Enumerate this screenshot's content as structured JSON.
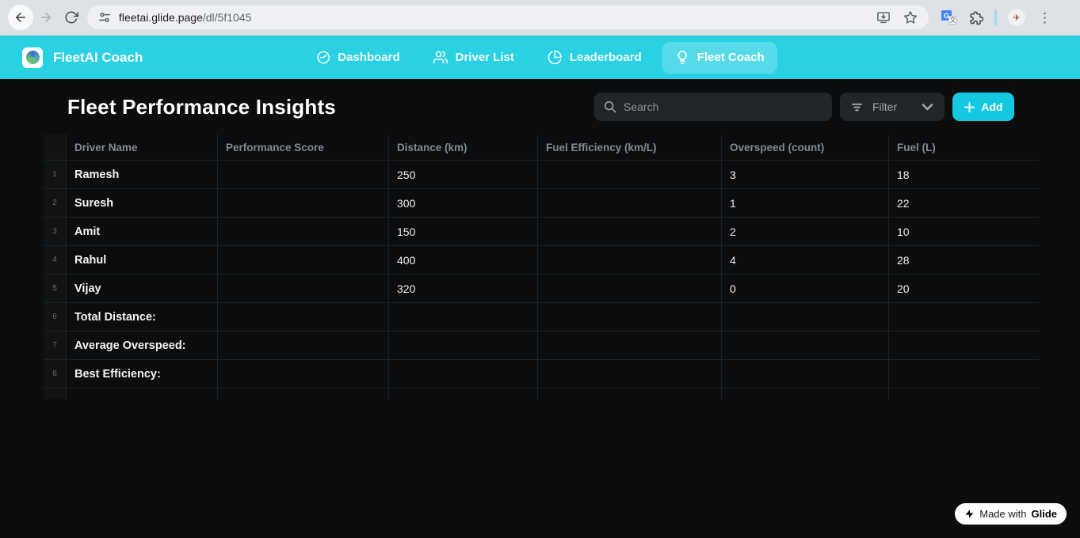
{
  "browser": {
    "url_host": "fleetai.glide.page",
    "url_path": "/dl/5f1045"
  },
  "header": {
    "app_title": "FleetAI Coach",
    "nav": [
      {
        "label": "Dashboard"
      },
      {
        "label": "Driver List"
      },
      {
        "label": "Leaderboard"
      },
      {
        "label": "Fleet Coach"
      }
    ]
  },
  "page": {
    "title": "Fleet Performance Insights",
    "search_placeholder": "Search",
    "filter_label": "Filter",
    "add_label": "Add"
  },
  "table": {
    "columns": [
      "Driver Name",
      "Performance Score",
      "Distance (km)",
      "Fuel Efficiency (km/L)",
      "Overspeed (count)",
      "Fuel (L)"
    ],
    "rows": [
      {
        "num": "1",
        "name": "Ramesh",
        "score": "",
        "distance": "250",
        "efficiency": "",
        "overspeed": "3",
        "fuel": "18"
      },
      {
        "num": "2",
        "name": "Suresh",
        "score": "",
        "distance": "300",
        "efficiency": "",
        "overspeed": "1",
        "fuel": "22"
      },
      {
        "num": "3",
        "name": "Amit",
        "score": "",
        "distance": "150",
        "efficiency": "",
        "overspeed": "2",
        "fuel": "10"
      },
      {
        "num": "4",
        "name": "Rahul",
        "score": "",
        "distance": "400",
        "efficiency": "",
        "overspeed": "4",
        "fuel": "28"
      },
      {
        "num": "5",
        "name": "Vijay",
        "score": "",
        "distance": "320",
        "efficiency": "",
        "overspeed": "0",
        "fuel": "20"
      },
      {
        "num": "6",
        "name": "Total Distance:",
        "score": "",
        "distance": "",
        "efficiency": "",
        "overspeed": "",
        "fuel": ""
      },
      {
        "num": "7",
        "name": "Average Overspeed:",
        "score": "",
        "distance": "",
        "efficiency": "",
        "overspeed": "",
        "fuel": ""
      },
      {
        "num": "8",
        "name": "Best Efficiency:",
        "score": "",
        "distance": "",
        "efficiency": "",
        "overspeed": "",
        "fuel": ""
      }
    ]
  },
  "badge": {
    "made_with": "Made with",
    "brand": "Glide"
  },
  "colors": {
    "accent_header": "#2ad1e2",
    "accent_button": "#15c8e0",
    "page_bg": "#0c0d0e",
    "toolbar_bg": "#dee1e6"
  }
}
